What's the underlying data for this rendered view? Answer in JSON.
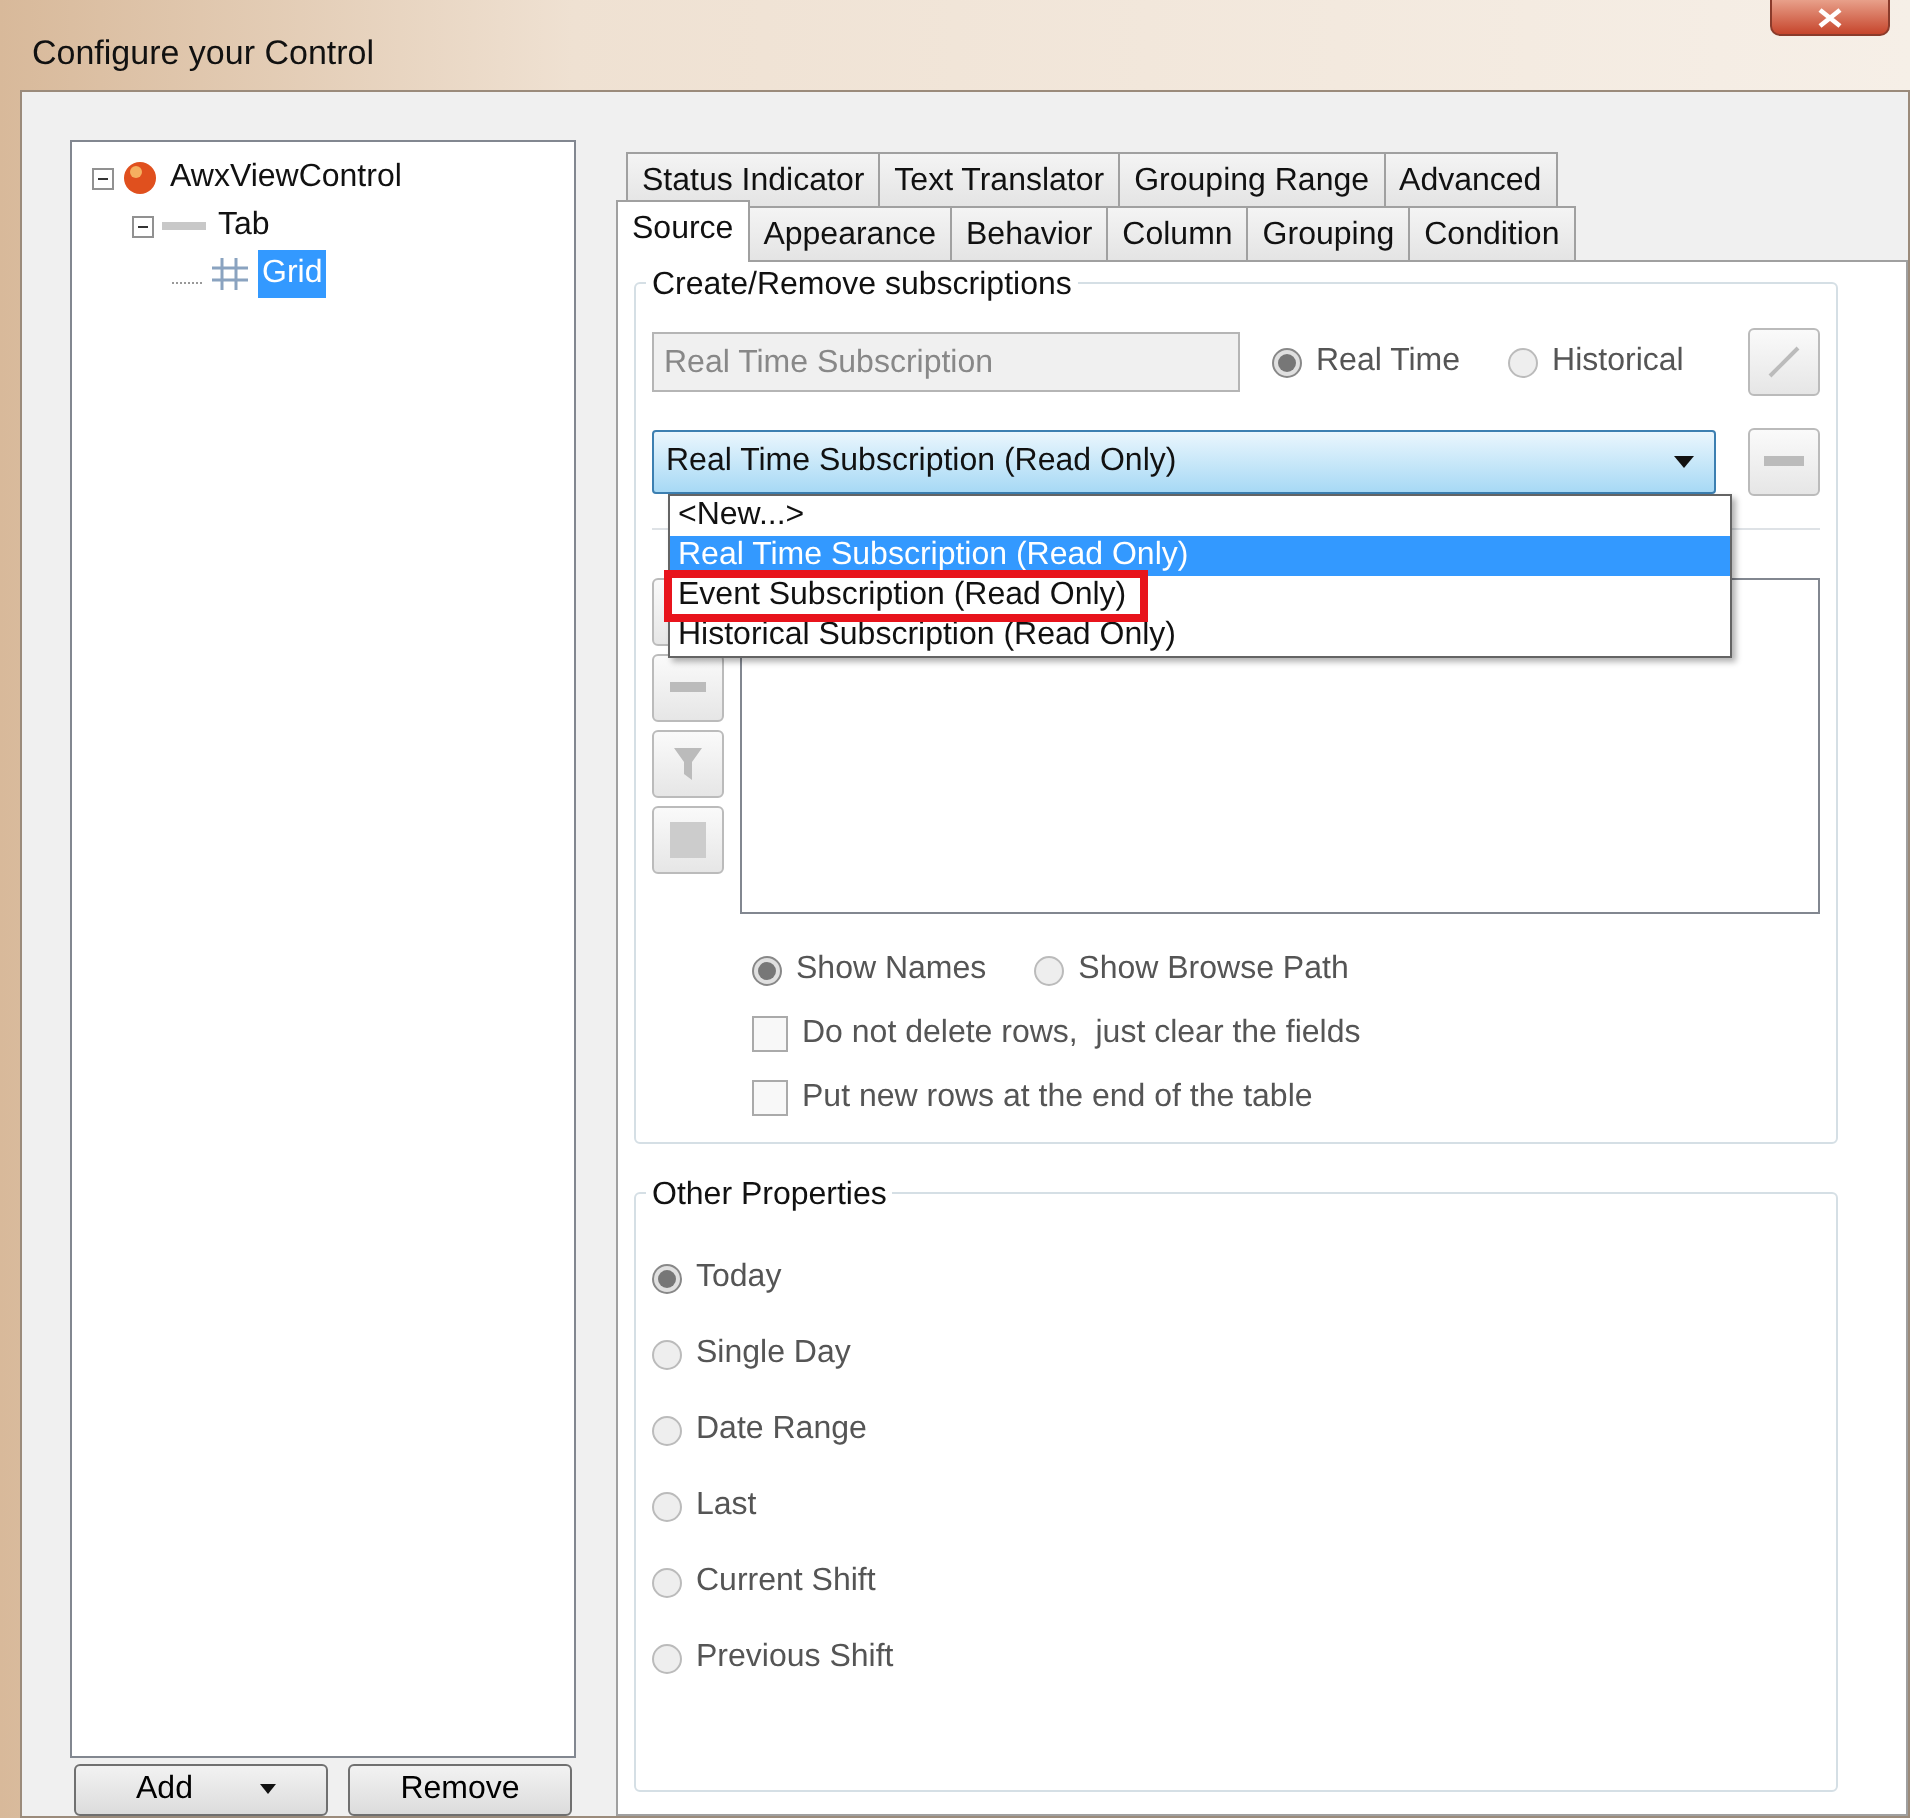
{
  "window": {
    "title": "Configure your Control"
  },
  "tree": [
    {
      "label": "AwxViewControl",
      "kind": "control",
      "expanded": true,
      "selected": false,
      "children": [
        {
          "label": "Tab",
          "kind": "tab",
          "expanded": true,
          "selected": false,
          "children": [
            {
              "label": "Grid",
              "kind": "grid",
              "selected": true
            }
          ]
        }
      ]
    }
  ],
  "tree_buttons": [
    {
      "label": "Add",
      "kind": "split"
    },
    {
      "label": "Remove",
      "kind": "plain"
    }
  ],
  "tabs": [
    [
      {
        "label": "Status Indicator",
        "selected": false
      },
      {
        "label": "Text Translator",
        "selected": false
      },
      {
        "label": "Grouping Range",
        "selected": false
      },
      {
        "label": "Advanced",
        "selected": false
      }
    ],
    [
      {
        "label": "Source",
        "selected": true
      },
      {
        "label": "Appearance",
        "selected": false
      },
      {
        "label": "Behavior",
        "selected": false
      },
      {
        "label": "Column",
        "selected": false
      },
      {
        "label": "Grouping",
        "selected": false
      },
      {
        "label": "Condition",
        "selected": false
      }
    ]
  ],
  "subscriptions": {
    "title": "Create/Remove subscriptions",
    "name_field": {
      "value": "Real Time Subscription",
      "disabled": true
    },
    "modes": [
      {
        "label": "Real Time",
        "selected": true
      },
      {
        "label": "Historical",
        "selected": false
      }
    ],
    "combo": {
      "value": "Real Time Subscription (Read Only)",
      "expanded": true,
      "options": [
        {
          "label": "<New...>",
          "selected": false,
          "highlighted": false
        },
        {
          "label": "Real Time Subscription (Read Only)",
          "selected": true,
          "highlighted": false
        },
        {
          "label": "Event Subscription (Read Only)",
          "selected": false,
          "highlighted": true
        },
        {
          "label": "Historical Subscription (Read Only)",
          "selected": false,
          "highlighted": false
        }
      ]
    },
    "display": [
      {
        "label": "Show Names",
        "selected": true
      },
      {
        "label": "Show Browse Path",
        "selected": false
      }
    ],
    "checks": [
      {
        "label": "Do not delete rows,  just clear the fields",
        "checked": false
      },
      {
        "label": "Put new rows at the end of the table",
        "checked": false
      }
    ]
  },
  "other": {
    "title": "Other Properties",
    "ranges": [
      {
        "label": "Today",
        "selected": true
      },
      {
        "label": "Single Day",
        "selected": false
      },
      {
        "label": "Date Range",
        "selected": false
      },
      {
        "label": "Last",
        "selected": false
      },
      {
        "label": "Current Shift",
        "selected": false
      },
      {
        "label": "Previous Shift",
        "selected": false
      }
    ]
  }
}
